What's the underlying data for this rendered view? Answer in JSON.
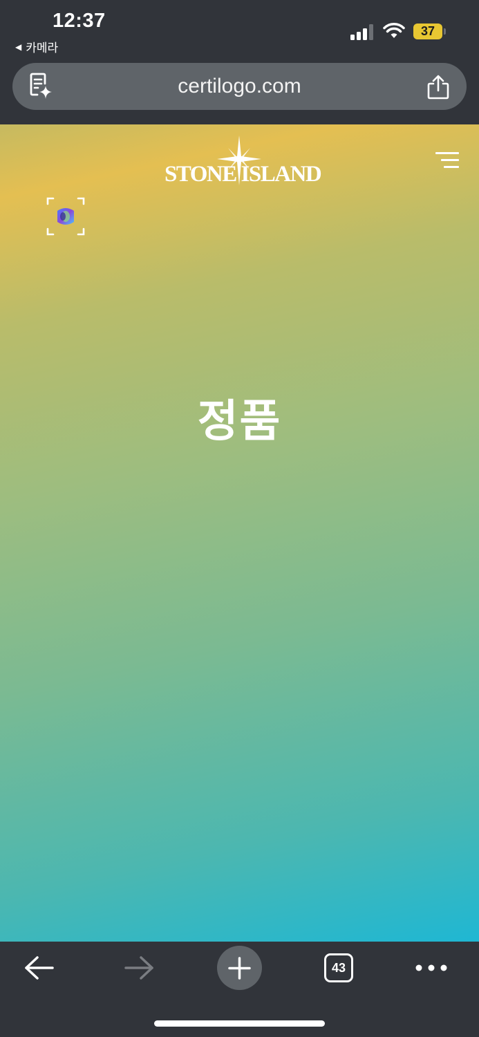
{
  "status_bar": {
    "time": "12:37",
    "back_app_label": "카메라",
    "back_icon": "back-triangle-icon",
    "battery_level": "37",
    "battery_color": "#e8c732",
    "signal_bars_active": 3,
    "signal_bars_total": 4
  },
  "browser": {
    "url": "certilogo.com",
    "reader_icon": "reader-sparkle-icon",
    "share_icon": "share-icon"
  },
  "page": {
    "brand": "STONE ISLAND",
    "menu_icon": "hamburger-menu-icon",
    "scan_icon": "scan-frame-icon",
    "result_text": "정품"
  },
  "toolbar": {
    "back_icon": "arrow-left-icon",
    "forward_icon": "arrow-right-icon",
    "new_tab_icon": "plus-icon",
    "tab_count": "43",
    "more_icon": "more-dots-icon"
  },
  "colors": {
    "chrome_bg": "#31343a",
    "url_bar_bg": "#5f6469",
    "gradient_top": "#e4bf52",
    "gradient_bottom": "#1fb7d3"
  }
}
